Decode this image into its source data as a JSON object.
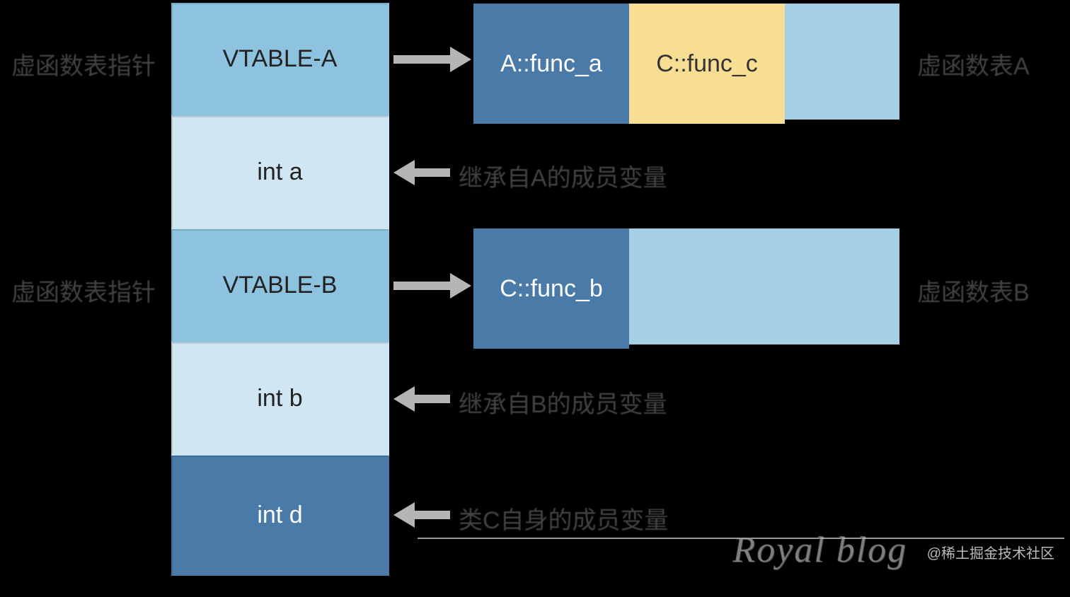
{
  "stack": {
    "vtable_a": "VTABLE-A",
    "int_a": "int a",
    "vtable_b": "VTABLE-B",
    "int_b": "int b",
    "int_d": "int d"
  },
  "vtable_a_funcs": {
    "func_a": "A::func_a",
    "func_c": "C::func_c"
  },
  "vtable_b_funcs": {
    "func_b": "C::func_b"
  },
  "ghost_labels": {
    "left_top": "虚函数表指针",
    "left_mid": "虚函数表指针",
    "note_int_a": "继承自A的成员变量",
    "note_int_b": "继承自B的成员变量",
    "note_int_d": "类C自身的成员变量",
    "right_top": "虚函数表A",
    "right_mid": "虚函数表B"
  },
  "watermark": {
    "big": "Royal  blog",
    "small": "@稀土掘金技术社区"
  }
}
